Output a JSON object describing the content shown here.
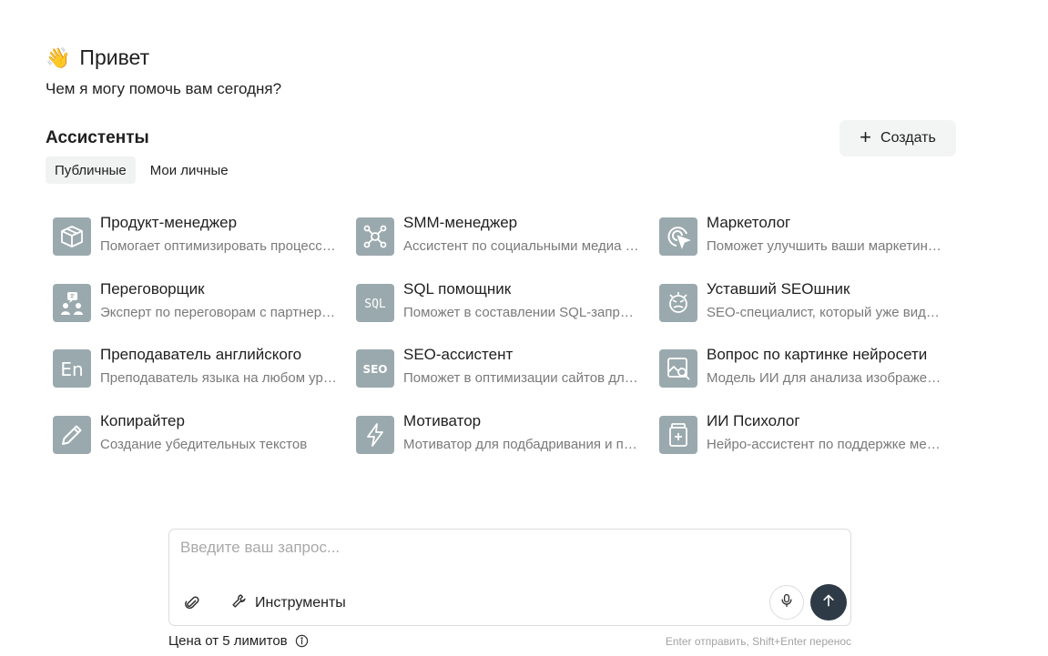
{
  "greeting": {
    "emoji": "👋",
    "title": "Привет",
    "subtitle": "Чем я могу помочь вам сегодня?"
  },
  "assistants": {
    "title": "Ассистенты",
    "create_label": "Создать",
    "tabs": [
      {
        "label": "Публичные",
        "active": true
      },
      {
        "label": "Мои личные",
        "active": false
      }
    ],
    "items": [
      {
        "title": "Продукт-менеджер",
        "desc": "Помогает оптимизировать процессы разработки продукта",
        "icon": "box-icon"
      },
      {
        "title": "SMM-менеджер",
        "desc": "Ассистент по социальными медиа и продвижению",
        "icon": "network-icon"
      },
      {
        "title": "Маркетолог",
        "desc": "Поможет улучшить ваши маркетинговые стратегии",
        "icon": "target-cursor-icon"
      },
      {
        "title": "Переговорщик",
        "desc": "Эксперт по переговорам с партнерами и клиентами",
        "icon": "people-chat-icon"
      },
      {
        "title": "SQL помощник",
        "desc": "Поможет в составлении SQL-запросов",
        "icon": "sql-icon"
      },
      {
        "title": "Уставший SEOшник",
        "desc": "SEO-специалист, который уже видел всё",
        "icon": "tired-face-icon"
      },
      {
        "title": "Преподаватель английского",
        "desc": "Преподаватель языка на любом уровне",
        "icon": "en-icon"
      },
      {
        "title": "SEO-ассистент",
        "desc": "Поможет в оптимизации сайтов для поиска",
        "icon": "seo-icon"
      },
      {
        "title": "Вопрос по картинке нейросети",
        "desc": "Модель ИИ для анализа изображений",
        "icon": "image-search-icon"
      },
      {
        "title": "Копирайтер",
        "desc": "Создание убедительных текстов",
        "icon": "pencil-icon"
      },
      {
        "title": "Мотиватор",
        "desc": "Мотиватор для подбадривания и поддержки",
        "icon": "lightning-icon"
      },
      {
        "title": "ИИ Психолог",
        "desc": "Нейро-ассистент по поддержке ментального здоровья",
        "icon": "medicine-jar-icon"
      }
    ]
  },
  "composer": {
    "placeholder": "Введите ваш запрос...",
    "value": "",
    "tools_label": "Инструменты"
  },
  "footer": {
    "price": "Цена от 5 лимитов",
    "hint": "Enter отправить, Shift+Enter перенос"
  },
  "colors": {
    "icon_bg": "#9aa9ad",
    "send_bg": "#2e3a45",
    "muted_text": "#7a7a7a"
  }
}
